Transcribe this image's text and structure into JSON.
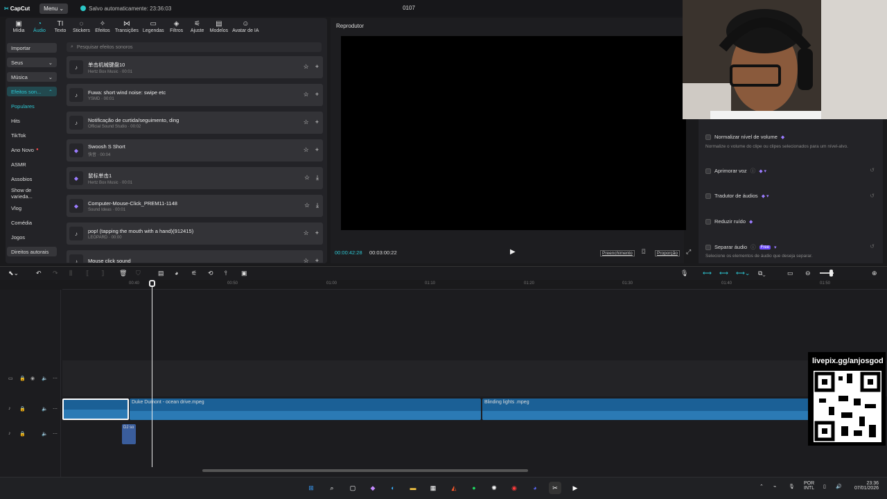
{
  "app": {
    "logo": "CapCut",
    "menu": "Menu",
    "saved": "Salvo automaticamente: 23:36:03",
    "project": "0107"
  },
  "toolbar": [
    {
      "label": "Mídia",
      "icon": "▣"
    },
    {
      "label": "Áudio",
      "icon": "◔"
    },
    {
      "label": "Texto",
      "icon": "TI"
    },
    {
      "label": "Stickers",
      "icon": "◌"
    },
    {
      "label": "Efeitos",
      "icon": "✧"
    },
    {
      "label": "Transições",
      "icon": "⋈"
    },
    {
      "label": "Legendas",
      "icon": "▭"
    },
    {
      "label": "Filtros",
      "icon": "◈"
    },
    {
      "label": "Ajuste",
      "icon": "⚟"
    },
    {
      "label": "Modelos",
      "icon": "▤"
    },
    {
      "label": "Avatar de IA",
      "icon": "☺"
    }
  ],
  "sidebar": {
    "importar": "Importar",
    "seus": "Seus",
    "musica": "Música",
    "efeitos": "Efeitos son...",
    "items": [
      "Populares",
      "Hits",
      "TikTok",
      "Ano Novo",
      "ASMR",
      "Assobios",
      "Show de varieda...",
      "Vlog",
      "Comédia",
      "Jogos"
    ],
    "direitos": "Direitos autorais"
  },
  "search": {
    "placeholder": "Pesquisar efeitos sonoros"
  },
  "sounds": [
    {
      "title": "单击机械键盘10",
      "sub": "Hertz Box Music · 00:01"
    },
    {
      "title": "Fuwa: short wind noise: swipe etc",
      "sub": "YSMD · 00:01"
    },
    {
      "title": "Notificação de curtida/seguimento, ding",
      "sub": "Official Sound Studio · 00:02"
    },
    {
      "title": "Swoosh S Short",
      "sub": "快音 · 00:04"
    },
    {
      "title": "鼠标单击1",
      "sub": "Hertz Box Music · 00:01"
    },
    {
      "title": "Computer-Mouse-Click_PREM11-1148",
      "sub": "Sound Ideas · 00:01"
    },
    {
      "title": "pop! (tapping the mouth with a hand)(912415)",
      "sub": "LEOPARD · 00:00"
    },
    {
      "title": "Mouse click sound",
      "sub": ""
    }
  ],
  "player": {
    "title": "Reprodutor",
    "current": "00:00:42:28",
    "total": "00:03:00:22",
    "fill": "Preenchimento",
    "ratio": "Proporção"
  },
  "audio_panel": {
    "normalize": "Normalizar nível de volume",
    "normalize_desc": "Normalize o volume do clipe ou clipes selecionados para um nível-alvo.",
    "enhance": "Aprimorar voz",
    "translate": "Tradutor de áudios",
    "noise": "Reduzir ruído",
    "separate": "Separar áudio",
    "free": "Free",
    "separate_desc": "Selecione os elementos de áudio que deseja separar."
  },
  "ruler": [
    "00:40",
    "00:50",
    "01:00",
    "01:10",
    "01:20",
    "01:30",
    "01:40",
    "01:50"
  ],
  "clips": {
    "a": "Duke Dumont - ocean drive.mpeg",
    "b": "Blinding lights .mpeg",
    "c": "DJ so"
  },
  "overlay": {
    "qr": "livepix.gg/anjosgod"
  },
  "tray": {
    "lang": "POR",
    "layout": "INTL",
    "time": "23:36",
    "date": "07/01/2026"
  }
}
